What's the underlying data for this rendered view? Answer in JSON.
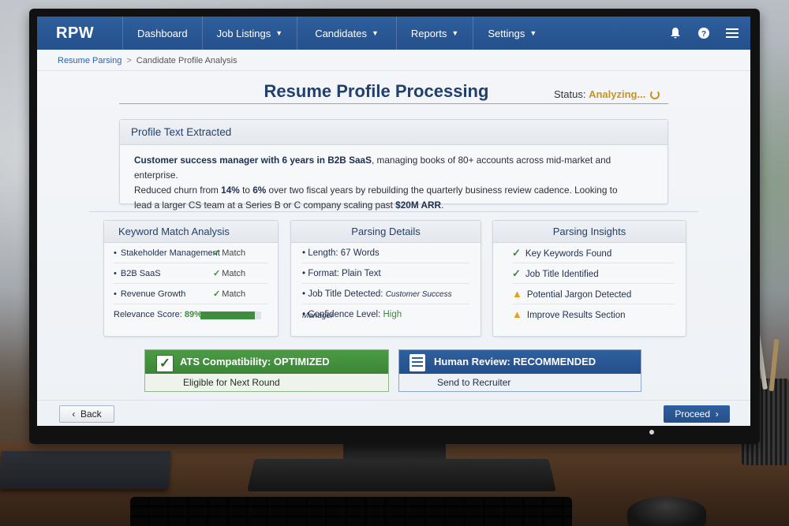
{
  "app": {
    "logo": "RPW"
  },
  "nav": {
    "items": [
      {
        "label": "Dashboard",
        "dropdown": false
      },
      {
        "label": "Job Listings",
        "dropdown": true
      },
      {
        "label": "Candidates",
        "dropdown": true
      },
      {
        "label": "Reports",
        "dropdown": true
      },
      {
        "label": "Settings",
        "dropdown": true
      }
    ],
    "icons": [
      "bell-icon",
      "help-icon",
      "menu-icon"
    ]
  },
  "breadcrumb": {
    "parent": "Resume Parsing",
    "separator": ">",
    "current": "Candidate Profile Analysis"
  },
  "page": {
    "title": "Resume Profile Processing",
    "status_label": "Status:",
    "status_value": "Analyzing...",
    "status_color": "#c9941a"
  },
  "extracted": {
    "heading": "Profile Text Extracted",
    "line1_bold": "Customer success manager with 6 years in B2B SaaS",
    "line1_rest": ", managing books of 80+ accounts across mid-market and enterprise.",
    "line2_a": "Reduced churn from ",
    "line2_b": "14%",
    "line2_c": " to ",
    "line2_d": "6%",
    "line2_e": " over two fiscal years by rebuilding the quarterly business review cadence. Looking to",
    "line3_a": "lead a larger CS team at a Series B or C company scaling past ",
    "line3_b": "$20M ARR",
    "line3_c": "."
  },
  "keyword_card": {
    "heading": "Keyword Match Analysis",
    "rows": [
      {
        "keyword": "Stakeholder Management",
        "result": "Match"
      },
      {
        "keyword": "B2B SaaS",
        "result": "Match"
      },
      {
        "keyword": "Revenue Growth",
        "result": "Match"
      }
    ],
    "score_label": "Relevance Score:",
    "score_value": "89%",
    "score_fraction": 0.89
  },
  "parsing_card": {
    "heading": "Parsing Details",
    "length": "Length: 67 Words",
    "format": "Format: Plain Text",
    "title_label": "Job Title Detected:",
    "title_value": "Customer Success Manager",
    "confidence_label": "Confidence Level:",
    "confidence_value": "High"
  },
  "insights_card": {
    "heading": "Parsing Insights",
    "rows": [
      {
        "icon": "check-icon",
        "text": "Key Keywords Found"
      },
      {
        "icon": "check-icon",
        "text": "Job Title Identified"
      },
      {
        "icon": "warning-icon",
        "text": "Potential Jargon Detected"
      },
      {
        "icon": "warning-icon",
        "text": "Improve Results Section"
      }
    ]
  },
  "ats": {
    "title": "ATS Compatibility: OPTIMIZED",
    "subtitle": "Eligible for Next Round",
    "color": "#3f8e3f"
  },
  "human": {
    "title": "Human Review: RECOMMENDED",
    "subtitle": "Send to Recruiter",
    "color": "#2a5a98"
  },
  "footer": {
    "back": "Back",
    "proceed": "Proceed"
  }
}
